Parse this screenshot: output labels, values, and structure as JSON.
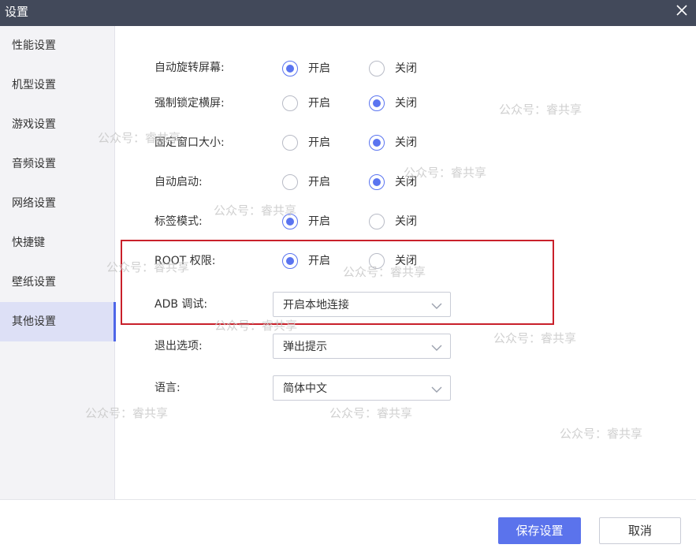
{
  "window": {
    "title": "设置"
  },
  "sidebar": {
    "items": [
      {
        "label": "性能设置",
        "active": false
      },
      {
        "label": "机型设置",
        "active": false
      },
      {
        "label": "游戏设置",
        "active": false
      },
      {
        "label": "音频设置",
        "active": false
      },
      {
        "label": "网络设置",
        "active": false
      },
      {
        "label": "快捷键",
        "active": false
      },
      {
        "label": "壁纸设置",
        "active": false
      },
      {
        "label": "其他设置",
        "active": true
      }
    ]
  },
  "settings": {
    "radio_rows": [
      {
        "label": "自动旋转屏幕:",
        "on_label": "开启",
        "off_label": "关闭",
        "selected": "on"
      },
      {
        "label": "强制锁定横屏:",
        "on_label": "开启",
        "off_label": "关闭",
        "selected": "off"
      },
      {
        "label": "固定窗口大小:",
        "on_label": "开启",
        "off_label": "关闭",
        "selected": "off"
      },
      {
        "label": "自动启动:",
        "on_label": "开启",
        "off_label": "关闭",
        "selected": "off"
      },
      {
        "label": "标签模式:",
        "on_label": "开启",
        "off_label": "关闭",
        "selected": "on"
      },
      {
        "label": "ROOT 权限:",
        "on_label": "开启",
        "off_label": "关闭",
        "selected": "on"
      }
    ],
    "select_rows": [
      {
        "label": "ADB 调试:",
        "value": "开启本地连接"
      },
      {
        "label": "退出选项:",
        "value": "弹出提示"
      },
      {
        "label": "语言:",
        "value": "简体中文"
      }
    ]
  },
  "footer": {
    "save_label": "保存设置",
    "cancel_label": "取消"
  },
  "watermark": {
    "text": "公众号：睿共享"
  },
  "colors": {
    "titlebar": "#42495a",
    "accent": "#5b73ec",
    "highlight_border": "#c9202a",
    "sidebar_bg": "#f3f3f6",
    "sidebar_active_bg": "#dde0f6"
  }
}
